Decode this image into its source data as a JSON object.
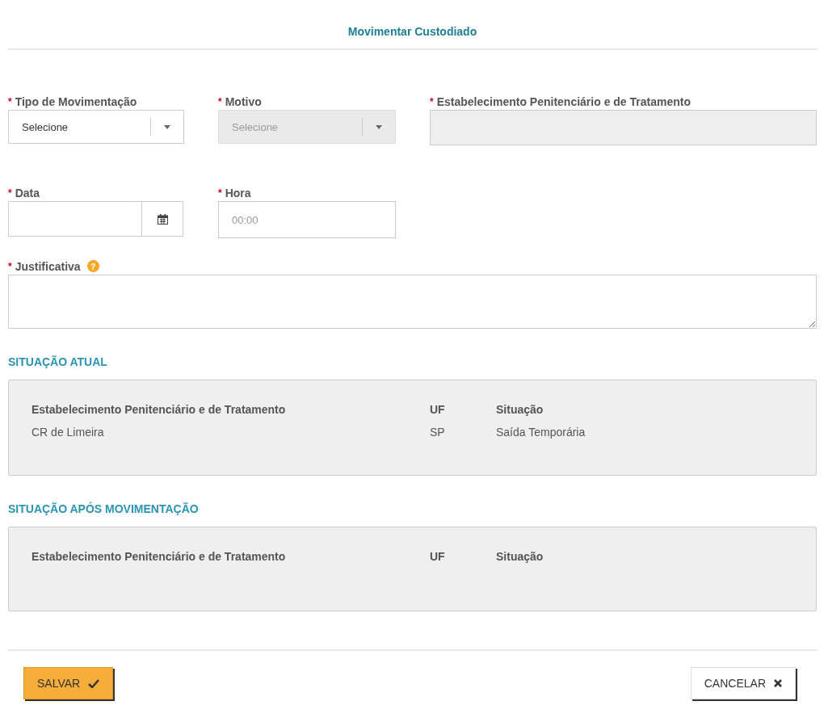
{
  "title": "Movimentar Custodiado",
  "required_mark": "*",
  "row_1": [
    {
      "kind": "select",
      "label": "Tipo de Movimentação",
      "required": true,
      "value": "Selecione",
      "disabled": false
    },
    {
      "kind": "select",
      "label": "Motivo",
      "required": true,
      "value": "Selecione",
      "disabled": true
    },
    {
      "kind": "text",
      "label": "Estabelecimento Penitenciário e de Tratamento",
      "required": true,
      "disabled": true
    }
  ],
  "row_2": [
    {
      "kind": "date",
      "label": "Data",
      "required": true,
      "disabled": false
    },
    {
      "kind": "text",
      "label": "Hora",
      "required": true,
      "placeholder": "00:00",
      "disabled": false
    }
  ],
  "justificativa": {
    "label": "Justificativa",
    "required": true,
    "help": "?"
  },
  "sections": [
    {
      "heading": "SITUAÇÃO ATUAL",
      "columns": [
        "Estabelecimento Penitenciário e de Tratamento",
        "UF",
        "Situação"
      ],
      "rows": [
        [
          "CR de Limeira",
          "SP",
          "Saída Temporária"
        ]
      ]
    },
    {
      "heading": "SITUAÇÃO APÓS MOVIMENTAÇÃO",
      "columns": [
        "Estabelecimento Penitenciário e de Tratamento",
        "UF",
        "Situação"
      ]
    }
  ],
  "buttons": [
    {
      "label": "SALVAR",
      "kind": "primary"
    },
    {
      "label": "CANCELAR",
      "kind": "secondary"
    }
  ]
}
